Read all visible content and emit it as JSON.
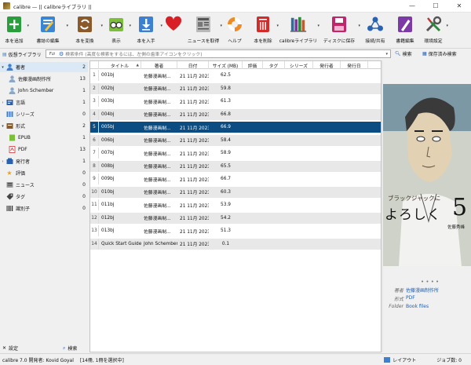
{
  "window": {
    "title": "calibre — || calibreライブラリ ||",
    "minimize": "—",
    "maximize": "☐",
    "close": "✕"
  },
  "toolbar": {
    "add_books": "本を追加",
    "edit_metadata": "書誌の編集",
    "convert_books": "本を変換",
    "view": "表示",
    "get_books": "本を入手",
    "fetch_news": "ニュースを取得",
    "help": "ヘルプ",
    "remove_books": "本を削除",
    "calibre_library": "calibreライブラリ",
    "save_to_disk": "ディスクに保存",
    "connect_share": "接続/共有",
    "edit_book": "書籍編集",
    "preferences": "環境設定"
  },
  "search": {
    "virtual_library": "仮想ライブラリ",
    "placeholder": "検索条件 (高度な検索をするには、左側の歯車アイコンをクリック)",
    "search_button": "検索",
    "saved_searches": "保存済み検索"
  },
  "tag_browser": {
    "authors": {
      "label": "著者",
      "count": "2"
    },
    "author_items": [
      {
        "label": "佐藤漫画制作所",
        "count": "13"
      },
      {
        "label": "John Schember",
        "count": "1"
      }
    ],
    "series": {
      "label": "シリーズ",
      "count": "0"
    },
    "languages": {
      "label": "言語",
      "count": "1"
    },
    "formats": {
      "label": "形式",
      "count": "2"
    },
    "format_items": [
      {
        "label": "EPUB",
        "count": "1"
      },
      {
        "label": "PDF",
        "count": "13"
      }
    ],
    "publisher": {
      "label": "発行者",
      "count": "1"
    },
    "rating": {
      "label": "評価",
      "count": "0"
    },
    "news": {
      "label": "ニュース",
      "count": "0"
    },
    "tags": {
      "label": "タグ",
      "count": "0"
    },
    "identifiers": {
      "label": "識別子",
      "count": "0"
    },
    "configure": "設定",
    "find": "検索"
  },
  "table": {
    "columns": [
      "タイトル",
      "著者",
      "日付",
      "サイズ (MB)",
      "評価",
      "タグ",
      "シリーズ",
      "発行者",
      "発行日"
    ],
    "sort_indicator": "▲",
    "rows": [
      {
        "n": "1",
        "title": "001bj",
        "author": "佐藤漫画制...",
        "date": "21 11月 2023",
        "size": "62.5"
      },
      {
        "n": "2",
        "title": "002bj",
        "author": "佐藤漫画制...",
        "date": "21 11月 2023",
        "size": "59.8"
      },
      {
        "n": "3",
        "title": "003bj",
        "author": "佐藤漫画制...",
        "date": "21 11月 2023",
        "size": "61.3"
      },
      {
        "n": "4",
        "title": "004bj",
        "author": "佐藤漫画制...",
        "date": "21 11月 2023",
        "size": "66.8"
      },
      {
        "n": "5",
        "title": "005bj",
        "author": "佐藤漫画制...",
        "date": "21 11月 2023",
        "size": "66.9"
      },
      {
        "n": "6",
        "title": "006bj",
        "author": "佐藤漫画制...",
        "date": "21 11月 2023",
        "size": "58.4"
      },
      {
        "n": "7",
        "title": "007bj",
        "author": "佐藤漫画制...",
        "date": "21 11月 2023",
        "size": "58.9"
      },
      {
        "n": "8",
        "title": "008bj",
        "author": "佐藤漫画制...",
        "date": "21 11月 2023",
        "size": "65.5"
      },
      {
        "n": "9",
        "title": "009bj",
        "author": "佐藤漫画制...",
        "date": "21 11月 2023",
        "size": "66.7"
      },
      {
        "n": "10",
        "title": "010bj",
        "author": "佐藤漫画制...",
        "date": "21 11月 2023",
        "size": "60.3"
      },
      {
        "n": "11",
        "title": "011bj",
        "author": "佐藤漫画制...",
        "date": "21 11月 2023",
        "size": "53.9"
      },
      {
        "n": "12",
        "title": "012bj",
        "author": "佐藤漫画制...",
        "date": "21 11月 2023",
        "size": "54.2"
      },
      {
        "n": "13",
        "title": "013bj",
        "author": "佐藤漫画制...",
        "date": "21 11月 2023",
        "size": "51.3"
      },
      {
        "n": "14",
        "title": "Quick Start Guide",
        "author": "John Schember",
        "date": "21 11月 2023",
        "size": "0.1"
      }
    ]
  },
  "cover": {
    "subtitle": "ブラックジャックに",
    "title": "よろしく",
    "volume": "5",
    "author": "佐藤秀峰"
  },
  "book_details": {
    "author_key": "著者",
    "author_value": "佐藤漫画制作所",
    "format_key": "形式",
    "format_value": "PDF",
    "folder_key": "Folder",
    "folder_value": "Book files"
  },
  "status": {
    "left": "calibre 7.0 開発者: Kovid Goyal",
    "selection": "[14冊, 1冊を選択中]",
    "layout": "レイアウト",
    "jobs": "ジョブ数: 0"
  }
}
